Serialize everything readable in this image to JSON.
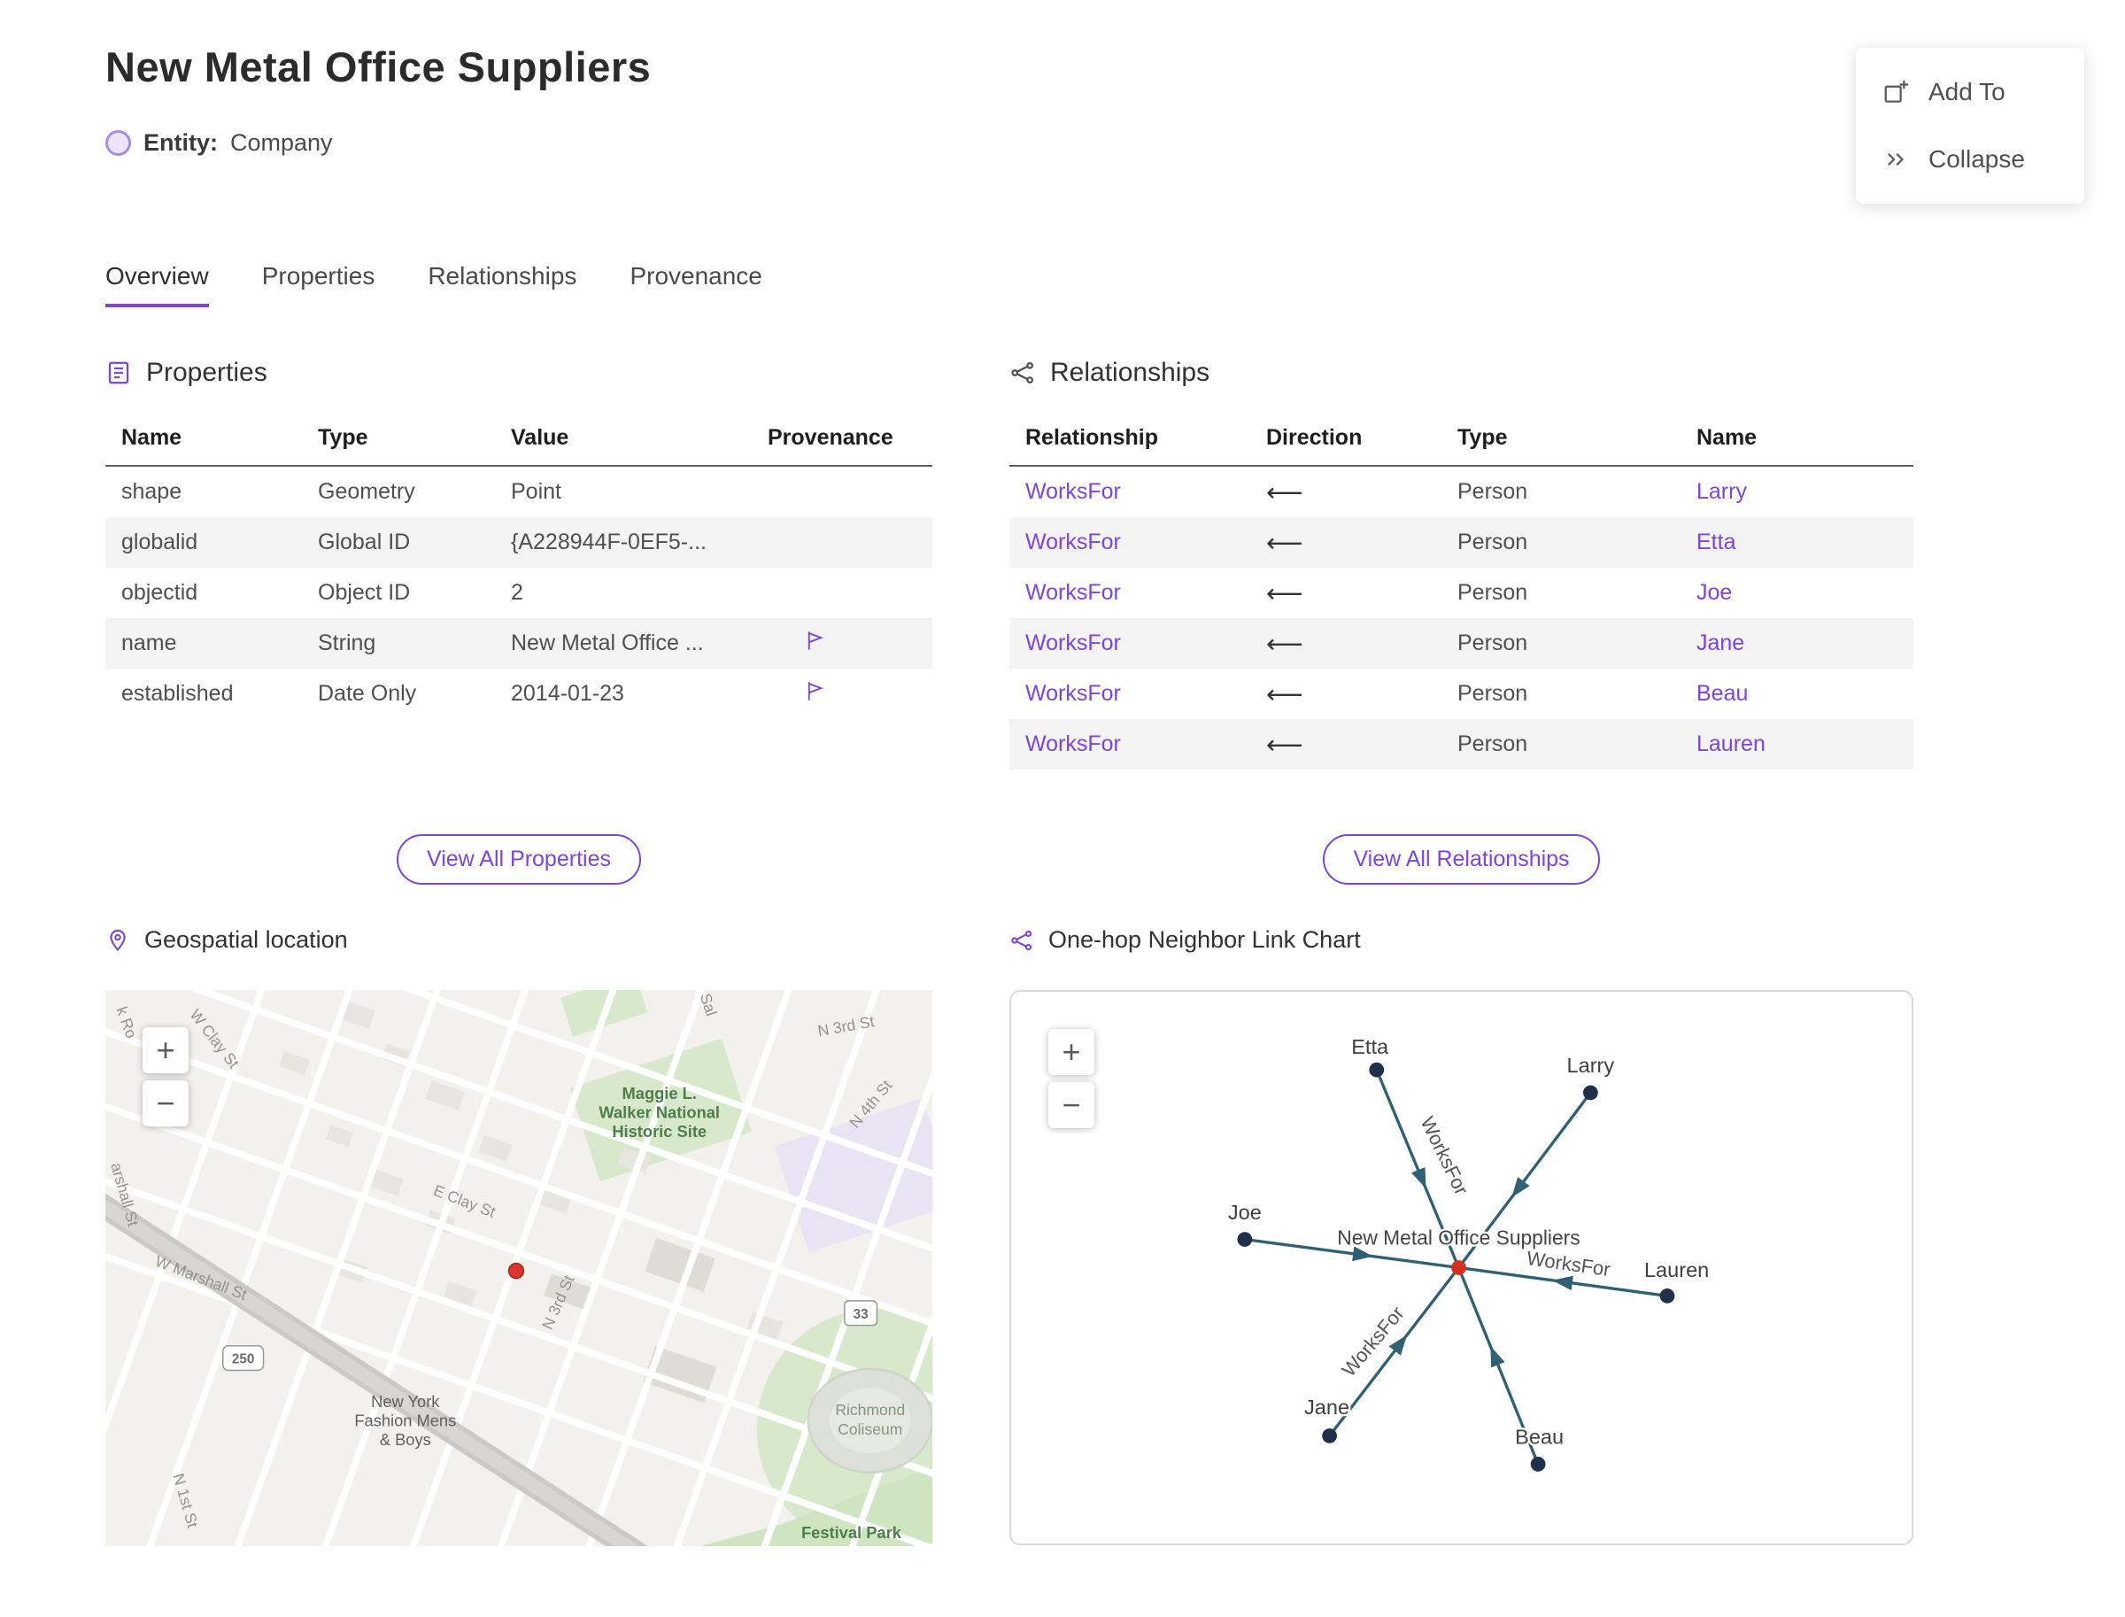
{
  "page": {
    "title": "New Metal Office Suppliers",
    "entity_label": "Entity:",
    "entity_type": "Company"
  },
  "actions": {
    "add_to": "Add To",
    "collapse": "Collapse"
  },
  "tabs": {
    "overview": "Overview",
    "properties": "Properties",
    "relationships": "Relationships",
    "provenance": "Provenance",
    "active": "Overview"
  },
  "properties_section": {
    "title": "Properties",
    "columns": [
      "Name",
      "Type",
      "Value",
      "Provenance"
    ],
    "rows": [
      {
        "name": "shape",
        "type": "Geometry",
        "value": "Point",
        "provenance": ""
      },
      {
        "name": "globalid",
        "type": "Global ID",
        "value": "{A228944F-0EF5-...",
        "provenance": ""
      },
      {
        "name": "objectid",
        "type": "Object ID",
        "value": "2",
        "provenance": ""
      },
      {
        "name": "name",
        "type": "String",
        "value": "New Metal Office ...",
        "provenance": "flag"
      },
      {
        "name": "established",
        "type": "Date Only",
        "value": "2014-01-23",
        "provenance": "flag"
      }
    ],
    "view_all": "View All Properties"
  },
  "relationships_section": {
    "title": "Relationships",
    "columns": [
      "Relationship",
      "Direction",
      "Type",
      "Name"
    ],
    "rows": [
      {
        "relationship": "WorksFor",
        "direction": "⟵",
        "type": "Person",
        "name": "Larry"
      },
      {
        "relationship": "WorksFor",
        "direction": "⟵",
        "type": "Person",
        "name": "Etta"
      },
      {
        "relationship": "WorksFor",
        "direction": "⟵",
        "type": "Person",
        "name": "Joe"
      },
      {
        "relationship": "WorksFor",
        "direction": "⟵",
        "type": "Person",
        "name": "Jane"
      },
      {
        "relationship": "WorksFor",
        "direction": "⟵",
        "type": "Person",
        "name": "Beau"
      },
      {
        "relationship": "WorksFor",
        "direction": "⟵",
        "type": "Person",
        "name": "Lauren"
      }
    ],
    "view_all": "View All Relationships"
  },
  "map_section": {
    "title": "Geospatial location",
    "zoom_in": "+",
    "zoom_out": "−",
    "labels": {
      "k_ro": "k Ro",
      "w_clay": "W Clay St",
      "sal": "Sal",
      "n3rd_top": "N 3rd St",
      "n4th": "N 4th St",
      "maggie1": "Maggie L.",
      "maggie2": "Walker National",
      "maggie3": "Historic Site",
      "marshall_left": "arshall St",
      "e_clay": "E Clay St",
      "w_marshall": "W Marshall St",
      "n3rd_mid": "N 3rd St",
      "shield_250": "250",
      "shield_33": "33",
      "ny1": "New York",
      "ny2": "Fashion Mens",
      "ny3": "& Boys",
      "richmond1": "Richmond",
      "richmond2": "Coliseum",
      "n1st": "N 1st St",
      "festival": "Festival Park"
    }
  },
  "chart_section": {
    "title": "One-hop Neighbor Link Chart",
    "zoom_in": "+",
    "zoom_out": "−",
    "center_label": "New Metal Office Suppliers",
    "edge_label": "WorksFor",
    "nodes": {
      "etta": "Etta",
      "larry": "Larry",
      "joe": "Joe",
      "lauren": "Lauren",
      "jane": "Jane",
      "beau": "Beau"
    }
  },
  "colors": {
    "accent": "#7d45d9",
    "link": "#7d45d9",
    "row_alt": "#f3f3f3",
    "edge": "#306074",
    "node": "#20304a",
    "center_node": "#d83020",
    "map_marker": "#d9372c",
    "park_green": "#d7e8cb"
  }
}
